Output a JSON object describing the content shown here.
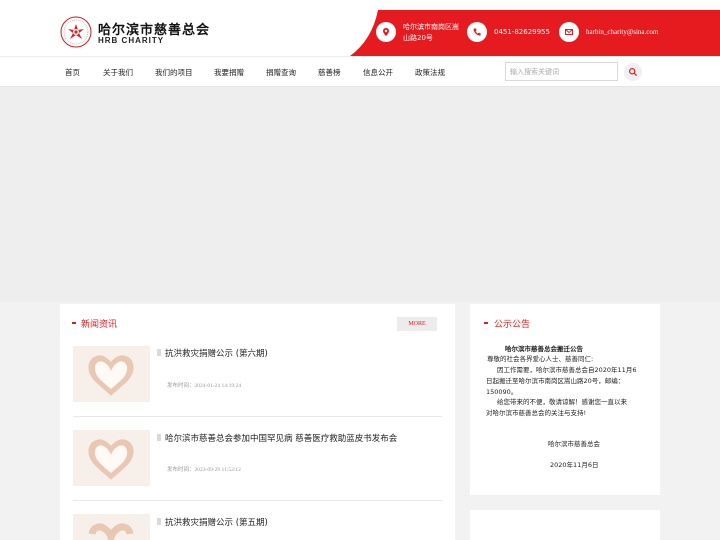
{
  "header": {
    "logo_cn": "哈尔滨市慈善总会",
    "logo_en": "HRB CHARITY",
    "address_line1": "哈尔滨市南岗区嵩",
    "address_line2": "山路20号",
    "phone": "0451-82629955",
    "email": "harbin_charity@sina.com",
    "accent_color": "#e51b1f",
    "icons": [
      "location-icon",
      "phone-icon",
      "email-icon"
    ]
  },
  "nav": {
    "items": [
      "首页",
      "关于我们",
      "我们的项目",
      "我要捐赠",
      "捐赠查询",
      "慈善榜",
      "信息公开",
      "政策法规"
    ],
    "search_placeholder": "输入搜索关键词"
  },
  "news": {
    "title": "新闻资讯",
    "more_label": "MORE",
    "items": [
      {
        "title": "抗洪救灾捐赠公示 (第六期)",
        "date": "发布时间：2024-01-24 14:19:24"
      },
      {
        "title": "哈尔滨市慈善总会参加中国罕见病 慈善医疗救助蓝皮书发布会",
        "date": "发布时间：2023-09-29 11:52:12"
      },
      {
        "title": "抗洪救灾捐赠公示 (第五期)",
        "date": ""
      }
    ]
  },
  "notice": {
    "title": "公示公告",
    "heading": "哈尔滨市慈善总会搬迁公告",
    "lines": [
      "尊敬的社会各界爱心人士、慈善同仁:",
      "因工作需要，哈尔滨市慈善总会自2020年11月6",
      "日起搬迁至哈尔滨市南岗区嵩山路20号，邮编：",
      "150090。",
      "给您带来的不便，敬请谅解！感谢您一直以来",
      "对哈尔滨市慈善总会的关注与支持!"
    ],
    "signature": "哈尔滨市慈善总会",
    "date": "2020年11月6日"
  }
}
